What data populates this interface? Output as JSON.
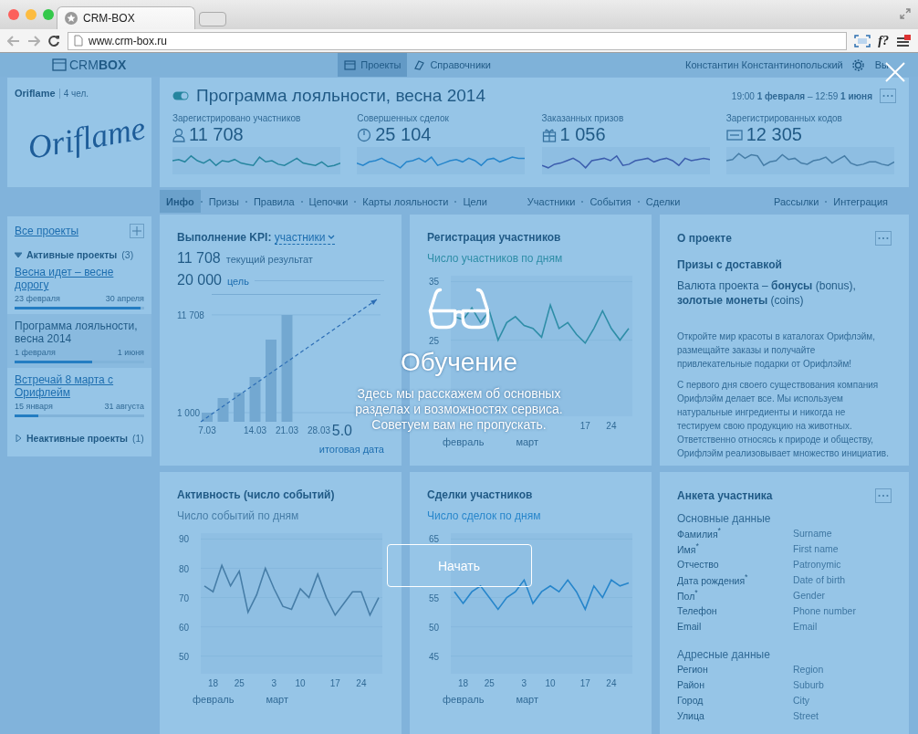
{
  "browser": {
    "tab_title": "CRM-BOX",
    "url": "www.crm-box.ru",
    "extension_label": "f?"
  },
  "app_header": {
    "logo": "CRM**BOX**",
    "nav": [
      {
        "label": "Проекты",
        "selected": true
      },
      {
        "label": "Справочники",
        "selected": false
      }
    ],
    "user": "Константин Константинопольский",
    "logout": "Вы"
  },
  "company": {
    "name": "Oriflame",
    "members": "4 чел.",
    "logo_text": "Oriflame"
  },
  "projects": {
    "all_link": "Все проекты",
    "groups": [
      {
        "label": "Активные проекты",
        "count": "(3)",
        "expanded": true,
        "items": [
          {
            "name": "Весна идет – весне дорогу",
            "start": "23 февраля",
            "end": "30 апреля",
            "level": 0.97,
            "selected": false
          },
          {
            "name": "Программа лояльности, весна 2014",
            "start": "1 февраля",
            "end": "1 июня",
            "level": 0.6,
            "selected": true
          },
          {
            "name": "Встречай 8 марта с Орифлейм",
            "start": "15 января",
            "end": "31 августа",
            "level": 0.18,
            "selected": false
          }
        ]
      },
      {
        "label": "Неактивные проекты",
        "count": "(1)",
        "expanded": false
      }
    ]
  },
  "project": {
    "active": true,
    "title": "Программа лояльности, весна 2014",
    "period": "19:00 **1 февраля** – 12:59 **1 июня**",
    "stats": [
      {
        "label": "Зарегистрировано участников",
        "value": "11 708"
      },
      {
        "label": "Совершенных сделок",
        "value": "25 104"
      },
      {
        "label": "Заказанных призов",
        "value": "1 056"
      },
      {
        "label": "Зарегистрированных кодов",
        "value": "12 305"
      }
    ]
  },
  "tabs": [
    [
      {
        "label": "Инфо",
        "selected": true
      },
      {
        "label": "Призы",
        "selected": false
      },
      {
        "label": "Правила",
        "selected": false
      },
      {
        "label": "Цепочки",
        "selected": false
      },
      {
        "label": "Карты лояльности",
        "selected": false
      },
      {
        "label": "Цели",
        "selected": false
      }
    ],
    [
      {
        "label": "Участники",
        "selected": false
      },
      {
        "label": "События",
        "selected": false
      },
      {
        "label": "Сделки",
        "selected": false
      }
    ],
    [
      {
        "label": "Рассылки",
        "selected": false
      },
      {
        "label": "Интеграция",
        "selected": false
      }
    ]
  ],
  "kpi_card": {
    "title": "Выполнение KPI:",
    "metric": "участники",
    "current_value": "11 708",
    "current_label": "текущий результат",
    "goal_value": "20 000",
    "goal_label": "цель",
    "end_date": "5.0",
    "end_date_label": "итоговая дата",
    "chart_data": {
      "type": "bar",
      "categories": [
        "7.03",
        null,
        null,
        "14.03",
        null,
        "21.03",
        null,
        "28.03"
      ],
      "values": [
        1000,
        2600,
        3200,
        4900,
        9000,
        11700,
        null,
        null
      ],
      "ylim": [
        0,
        14000
      ],
      "yticks": [
        {
          "value": 1000,
          "label": "1 000"
        },
        {
          "value": 11708,
          "label": "11 708"
        }
      ]
    }
  },
  "registration_card": {
    "title": "Регистрация участников",
    "months": [
      "февраль",
      "март"
    ],
    "chart_data": {
      "type": "line",
      "categories": [
        null,
        null,
        null,
        null,
        null,
        null,
        null,
        null,
        null,
        null,
        null,
        null,
        null,
        null,
        null,
        "17",
        null,
        null,
        "24",
        null,
        null
      ],
      "series": [
        {
          "name": "Число участников по дням",
          "color": "#2f8f7f",
          "values": [
            29,
            28.5,
            30.5,
            28,
            30,
            25,
            28,
            29,
            27.5,
            27,
            25.5,
            31,
            27,
            28,
            26,
            24.5,
            27,
            30,
            27,
            25,
            27
          ]
        }
      ],
      "ylim": [
        12,
        36
      ],
      "yticks": [
        25,
        35
      ],
      "grid": true
    }
  },
  "about_card": {
    "title": "О проекте",
    "prizes": "Призы с доставкой",
    "currency": "Валюта проекта – **бонусы** (bonus), **золотые монеты** (coins)",
    "paragraphs": [
      "Откройте мир красоты в каталогах Орифлэйм, размещайте заказы и получайте привлекательные подарки от Орифлэйм!",
      "С первого дня своего существования компания Орифлэйм делает все. Мы используем натуральные ингредиенты и никогда не тестируем свою продукцию на животных. Ответственно относясь к природе и обществу, Орифлэйм реализовывает множество инициатив."
    ]
  },
  "activity_card": {
    "title": "Активность (число событий)",
    "months": [
      "февраль",
      "март"
    ],
    "chart_data": {
      "type": "line",
      "categories": [
        null,
        "18",
        null,
        null,
        "25",
        null,
        null,
        null,
        "3",
        null,
        null,
        "10",
        null,
        null,
        null,
        "17",
        null,
        null,
        "24",
        null,
        null
      ],
      "series": [
        {
          "name": "Число событий по дням",
          "color": "#5f6f7f",
          "values": [
            74,
            72,
            81,
            74,
            79,
            65,
            71,
            80,
            73,
            67,
            66,
            73,
            70,
            78,
            70,
            64,
            68,
            72,
            72,
            64,
            70
          ]
        }
      ],
      "ylim": [
        44,
        92
      ],
      "yticks": [
        50,
        60,
        70,
        80,
        90
      ],
      "grid": true
    }
  },
  "deals_card": {
    "title": "Сделки участников",
    "months": [
      "февраль",
      "март"
    ],
    "chart_data": {
      "type": "line",
      "categories": [
        null,
        "18",
        null,
        null,
        "25",
        null,
        null,
        null,
        "3",
        null,
        null,
        "10",
        null,
        null,
        null,
        "17",
        null,
        null,
        "24",
        null,
        null
      ],
      "series": [
        {
          "name": "Число сделок по дням",
          "color": "#1f7fc6",
          "values": [
            56,
            54,
            56,
            57,
            55,
            53,
            55,
            56,
            58,
            54,
            56,
            57,
            56,
            58,
            56,
            53,
            57,
            55,
            58,
            57,
            57.5
          ]
        }
      ],
      "ylim": [
        42,
        66
      ],
      "yticks": [
        45,
        50,
        55,
        65
      ],
      "grid": true
    }
  },
  "form_card": {
    "title": "Анкета участника",
    "sections": [
      {
        "title": "Основные данные",
        "fields": [
          {
            "label": "Фамилия$^{*}$",
            "placeholder": "Surname"
          },
          {
            "label": "Имя$^{*}$",
            "placeholder": "First name"
          },
          {
            "label": "Отчество",
            "placeholder": "Patronymic"
          },
          {
            "label": "Дата рождения$^{*}$",
            "placeholder": "Date of birth"
          },
          {
            "label": "Пол$^{*}$",
            "placeholder": "Gender"
          },
          {
            "label": "Телефон",
            "placeholder": "Phone number"
          },
          {
            "label": "Email",
            "placeholder": "Email"
          }
        ]
      },
      {
        "title": "Адресные данные",
        "fields": [
          {
            "label": "Регион",
            "placeholder": "Region"
          },
          {
            "label": "Район",
            "placeholder": "Suburb"
          },
          {
            "label": "Город",
            "placeholder": "City"
          },
          {
            "label": "Улица",
            "placeholder": "Street"
          }
        ]
      }
    ]
  },
  "tutorial": {
    "title": "Обучение",
    "text_lines": [
      "Здесь мы расскажем об основных",
      "разделах и возможностях сервиса.",
      "Советуем вам не пропускать."
    ],
    "button": "Начать"
  }
}
